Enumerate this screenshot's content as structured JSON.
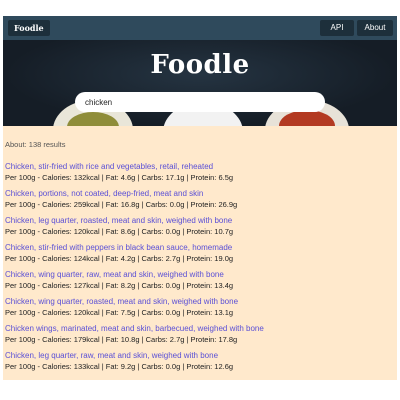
{
  "nav": {
    "brand": "Foodle",
    "api": "API",
    "about": "About"
  },
  "hero": {
    "title": "Foodle"
  },
  "search": {
    "value": "chicken"
  },
  "results_summary": "About: 138 results",
  "results": [
    {
      "title": "Chicken, stir-fried with rice and vegetables, retail, reheated",
      "info": "Per 100g - Calories: 132kcal | Fat: 4.6g | Carbs: 17.1g | Protein: 6.5g"
    },
    {
      "title": "Chicken, portions, not coated, deep-fried, meat and skin",
      "info": "Per 100g - Calories: 259kcal | Fat: 16.8g | Carbs: 0.0g | Protein: 26.9g"
    },
    {
      "title": "Chicken, leg quarter, roasted, meat and skin, weighed with bone",
      "info": "Per 100g - Calories: 120kcal | Fat: 8.6g | Carbs: 0.0g | Protein: 10.7g"
    },
    {
      "title": "Chicken, stir-fried with peppers in black bean sauce, homemade",
      "info": "Per 100g - Calories: 124kcal | Fat: 4.2g | Carbs: 2.7g | Protein: 19.0g"
    },
    {
      "title": "Chicken, wing quarter, raw, meat and skin, weighed with bone",
      "info": "Per 100g - Calories: 127kcal | Fat: 8.2g | Carbs: 0.0g | Protein: 13.4g"
    },
    {
      "title": "Chicken, wing quarter, roasted, meat and skin, weighed with bone",
      "info": "Per 100g - Calories: 120kcal | Fat: 7.5g | Carbs: 0.0g | Protein: 13.1g"
    },
    {
      "title": "Chicken wings, marinated, meat and skin, barbecued, weighed with bone",
      "info": "Per 100g - Calories: 179kcal | Fat: 10.8g | Carbs: 2.7g | Protein: 17.8g"
    },
    {
      "title": "Chicken, leg quarter, raw, meat and skin, weighed with bone",
      "info": "Per 100g - Calories: 133kcal | Fat: 9.2g | Carbs: 0.0g | Protein: 12.6g"
    }
  ]
}
